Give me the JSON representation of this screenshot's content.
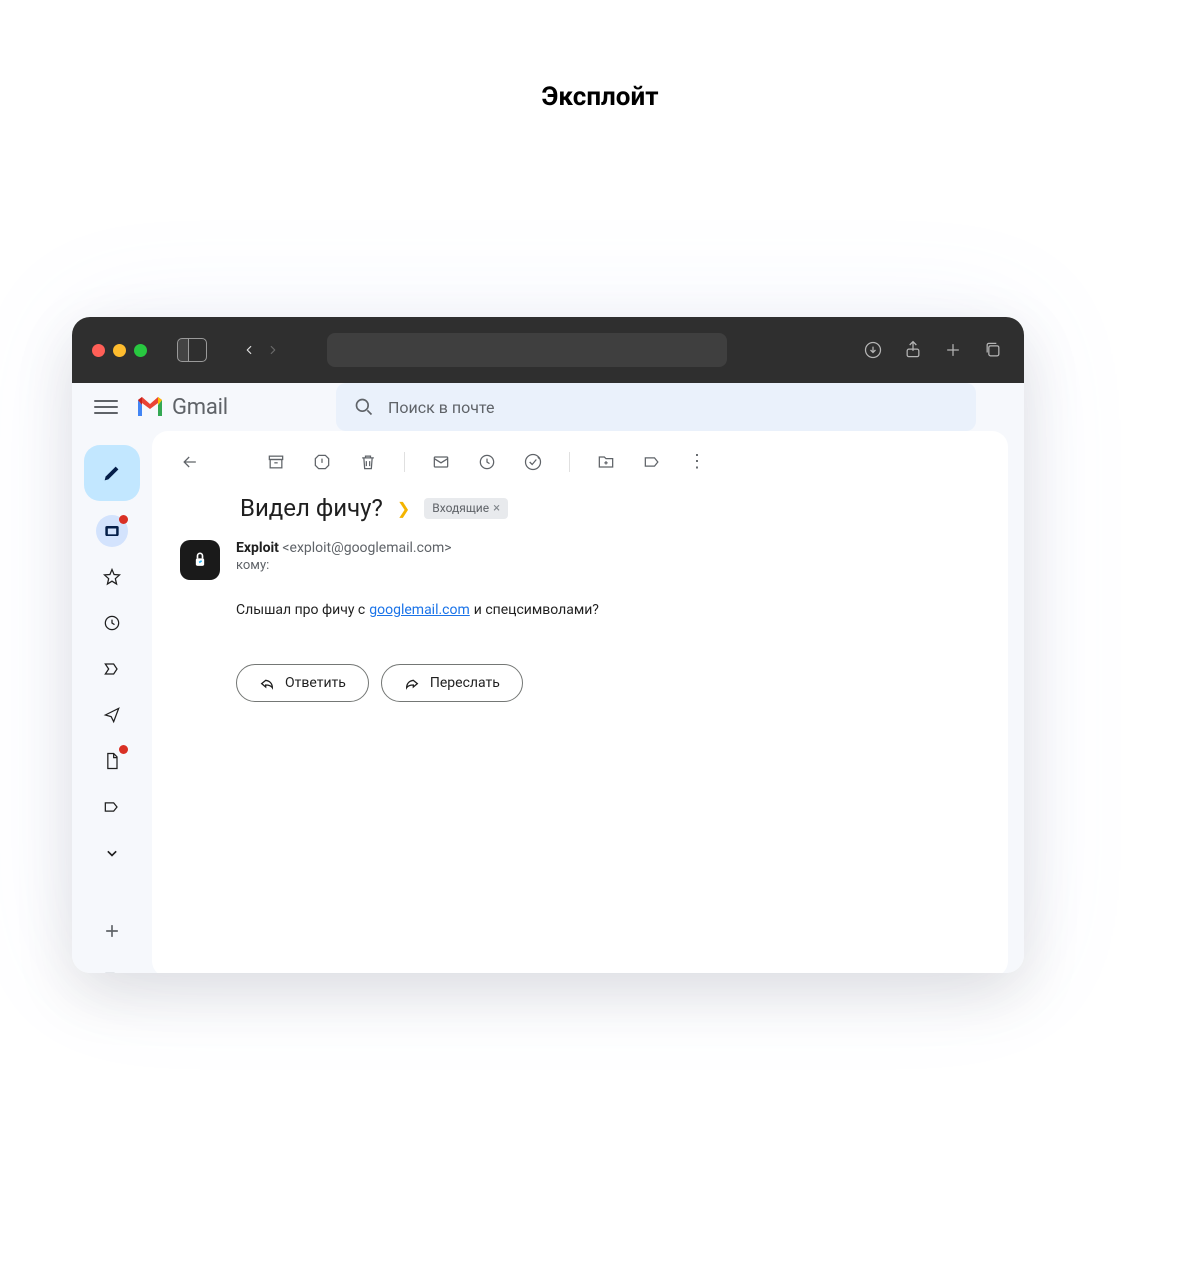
{
  "page": {
    "title": "Эксплойт"
  },
  "gmail": {
    "brand": "Gmail",
    "search_placeholder": "Поиск в почте"
  },
  "email": {
    "subject": "Видел фичу?",
    "inbox_label": "Входящие",
    "sender_name": "Exploit",
    "sender_email": "<exploit@googlemail.com>",
    "to_label": "кому:",
    "body_before": "Слышал про фичу с",
    "body_link": "googlemail.com",
    "body_after": "и спецсимволами?"
  },
  "actions": {
    "reply": "Ответить",
    "forward": "Переслать"
  }
}
